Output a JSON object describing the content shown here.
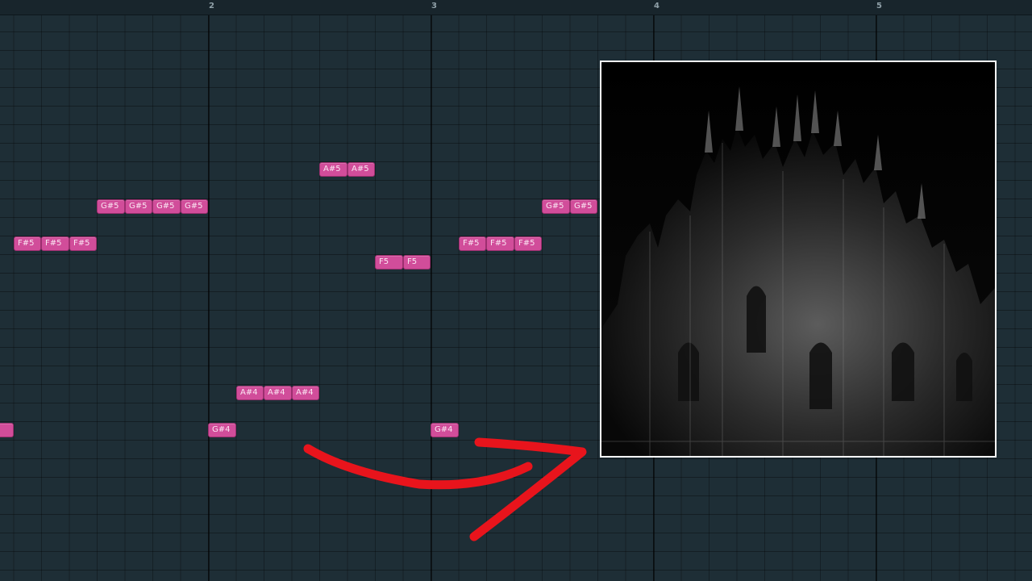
{
  "ruler": {
    "bars": [
      "2",
      "3",
      "4",
      "5"
    ]
  },
  "notes": [
    {
      "label": "..."
    },
    {
      "label": "F#5"
    },
    {
      "label": "F#5"
    },
    {
      "label": "F#5"
    },
    {
      "label": "G#5"
    },
    {
      "label": "G#5"
    },
    {
      "label": "G#5"
    },
    {
      "label": "G#5"
    },
    {
      "label": "G#4"
    },
    {
      "label": "A#4"
    },
    {
      "label": "A#4"
    },
    {
      "label": "A#4"
    },
    {
      "label": "A#5"
    },
    {
      "label": "A#5"
    },
    {
      "label": "F5"
    },
    {
      "label": "F5"
    },
    {
      "label": "G#4"
    },
    {
      "label": "F#5"
    },
    {
      "label": "F#5"
    },
    {
      "label": "F#5"
    },
    {
      "label": "G#5"
    },
    {
      "label": "G#5"
    }
  ],
  "artwork": {
    "subject": "gothic-cathedral-night"
  },
  "colors": {
    "note": "#d14d9a",
    "arrow": "#e8141c",
    "grid": "#1e2e36"
  }
}
